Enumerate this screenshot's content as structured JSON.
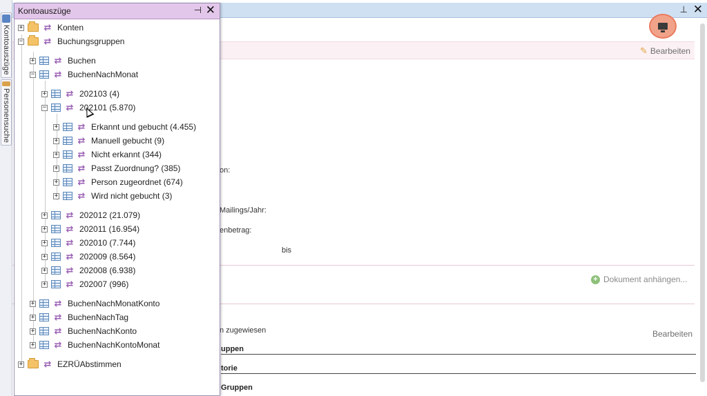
{
  "dock": {
    "tabs": [
      {
        "label": "Kontoauszüge"
      },
      {
        "label": "Personensuche"
      }
    ]
  },
  "panel": {
    "title": "Kontoauszüge",
    "pin_icon": "pin-icon",
    "close_icon": "close-icon"
  },
  "tree": {
    "konten": "Konten",
    "buchungsgruppen": "Buchungsgruppen",
    "buchen": "Buchen",
    "buchen_nach_monat": "BuchenNachMonat",
    "m202103": "202103 (4)",
    "m202101": "202101 (5.870)",
    "erkannt": "Erkannt und gebucht (4.455)",
    "manuell": "Manuell gebucht (9)",
    "nicht_erkannt": "Nicht erkannt (344)",
    "passt": "Passt Zuordnung? (385)",
    "person": "Person zugeordnet (674)",
    "wird_nicht": "Wird nicht gebucht (3)",
    "m202012": "202012 (21.079)",
    "m202011": "202011 (16.954)",
    "m202010": "202010 (7.744)",
    "m202009": "202009 (8.564)",
    "m202008": "202008 (6.938)",
    "m202007": "202007 (996)",
    "buchen_nach_monat_konto": "BuchenNachMonatKonto",
    "buchen_nach_tag": "BuchenNachTag",
    "buchen_nach_konto": "BuchenNachKonto",
    "buchen_nach_konto_monat": "BuchenNachKontoMonat",
    "ezru": "EZRÜAbstimmen"
  },
  "main": {
    "edit_label_top": "Bearbeiten",
    "label_on": "on:",
    "label_mailings": "Mailings/Jahr:",
    "label_betrag": "enbetrag:",
    "label_bis": "bis",
    "attach_label": "Dokument anhängen...",
    "zugewiesen": "n zugewiesen",
    "edit_label_bottom": "Bearbeiten",
    "section_gruppen_partial": "uppen",
    "section_torie": "torie",
    "section_gruppen": "Gruppen"
  },
  "colors": {
    "panel_header": "#e3c7ea",
    "accent_arrows": "#9a5fb4",
    "record_button": "#f1a38a"
  }
}
